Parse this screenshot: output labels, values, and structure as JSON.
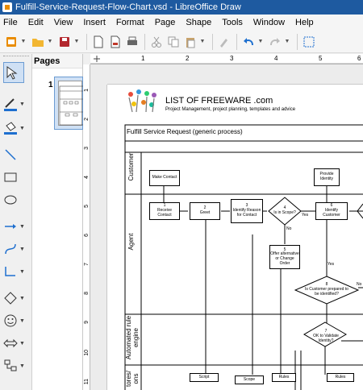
{
  "window": {
    "title": "Fulfill-Service-Request-Flow-Chart.vsd - LibreOffice Draw"
  },
  "menu": [
    "File",
    "Edit",
    "View",
    "Insert",
    "Format",
    "Page",
    "Shape",
    "Tools",
    "Window",
    "Help"
  ],
  "panel": {
    "title": "Pages",
    "page_number": "1"
  },
  "ruler_top": [
    "1",
    "2",
    "3",
    "4",
    "5",
    "6"
  ],
  "ruler_left": [
    "1",
    "2",
    "3",
    "4",
    "5",
    "6",
    "7",
    "8",
    "9",
    "10",
    "11"
  ],
  "diagram": {
    "logo_text": "LIST OF FREEWARE .com",
    "tagline": "Project Management, project planning, templates and advice",
    "title": "Fulfill Service Request (generic process)",
    "lanes": [
      "Customer",
      "Agent",
      "Automated rule engine",
      "tores/ ons"
    ],
    "boxes": {
      "make_contact": "Make Contact",
      "provide_identity": "Provide Identity",
      "receive_contact": "1\nReceive Contact",
      "greet": "2\nGreet",
      "identify_reason": "3\nIdentify Reason for Contact",
      "is_in_scope": "4\nIs in Scope?",
      "identify_customer": "6\nIdentify Customer",
      "offer_alternative": "5\nOffer alternative or Change Order",
      "customer_prepared": "8\nIs Customer prepared to be identified?",
      "ok_to_identify": "7\nOK to Validate Identity?",
      "script": "Script",
      "scope": "Scope",
      "rules1": "Rules",
      "rules2": "Rules"
    },
    "edge_labels": {
      "yes1": "Yes",
      "no1": "No",
      "yes2": "Yes",
      "no2": "No"
    }
  },
  "colors": {
    "titlebar": "#1e5aa0",
    "selection": "#cfe0f4",
    "accent_blue": "#1e6fcf"
  }
}
